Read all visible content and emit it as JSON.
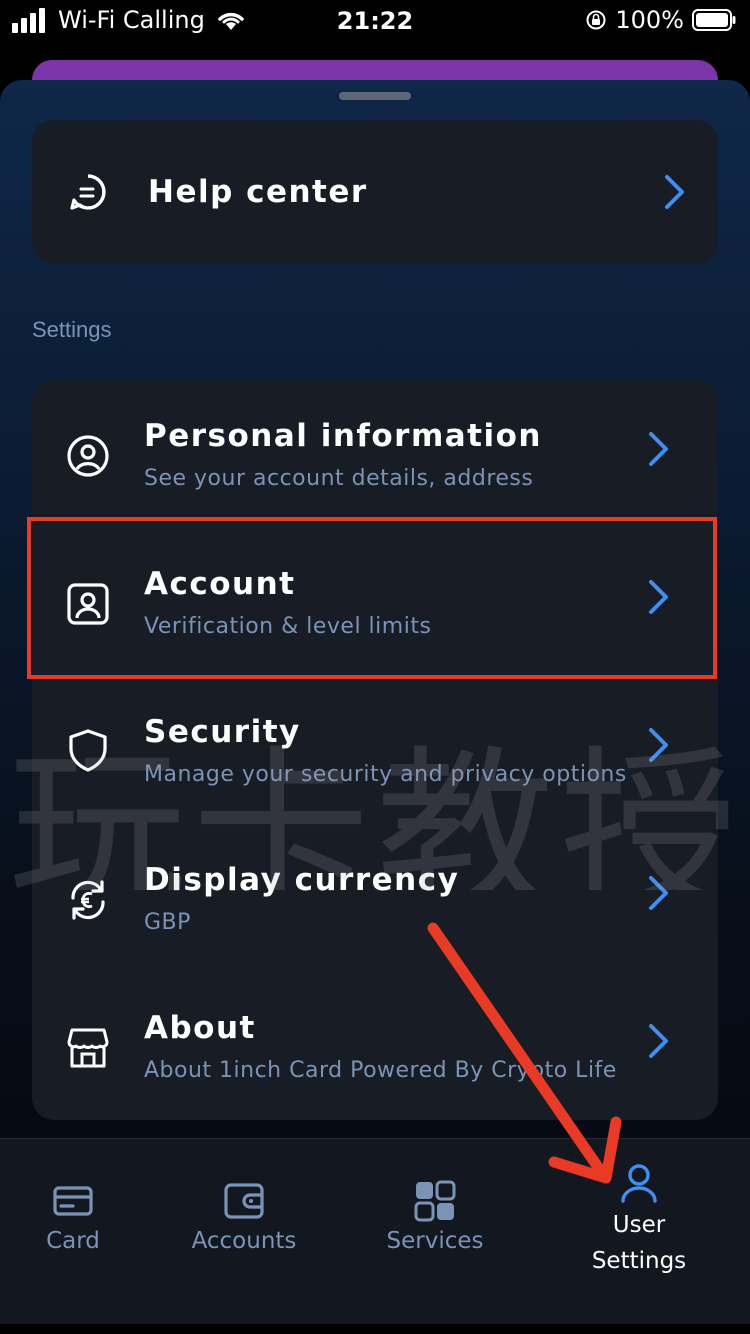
{
  "status_bar": {
    "carrier": "Wi-Fi Calling",
    "time": "21:22",
    "battery": "100%"
  },
  "help": {
    "title": "Help center"
  },
  "settings": {
    "section_label": "Settings",
    "items": [
      {
        "title": "Personal information",
        "subtitle": "See your account details, address",
        "icon": "user-circle-icon"
      },
      {
        "title": "Account",
        "subtitle": "Verification & level limits",
        "icon": "id-card-icon"
      },
      {
        "title": "Security",
        "subtitle": "Manage your security and privacy options",
        "icon": "shield-icon"
      },
      {
        "title": "Display currency",
        "subtitle": "GBP",
        "icon": "currency-exchange-icon"
      },
      {
        "title": "About",
        "subtitle": "About 1inch Card Powered By Crypto Life",
        "icon": "store-icon"
      }
    ]
  },
  "watermark": "玩卡教授",
  "tabs": [
    {
      "label": "Card",
      "icon": "card-icon"
    },
    {
      "label": "Accounts",
      "icon": "wallet-icon"
    },
    {
      "label": "Services",
      "icon": "grid-icon"
    },
    {
      "label": "User Settings",
      "line1": "User",
      "line2": "Settings",
      "icon": "user-icon",
      "active": true
    }
  ],
  "colors": {
    "accent": "#3d8ff0",
    "highlight": "#e83a24",
    "subtitle": "#7b93b6",
    "card_bg": "#181c25"
  }
}
